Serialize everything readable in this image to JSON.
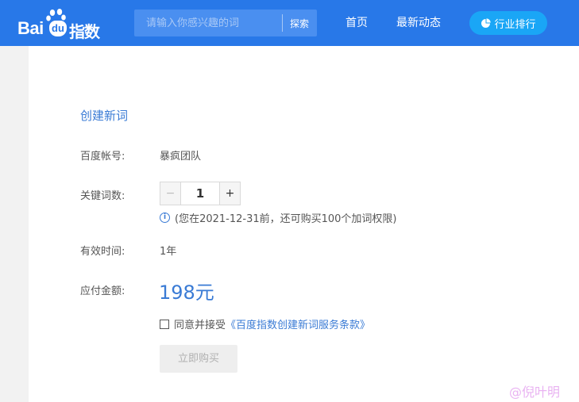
{
  "header": {
    "logo_text_left": "Bai",
    "logo_text_mid": "du",
    "logo_text_right": "指数",
    "search": {
      "placeholder": "请输入你感兴趣的词",
      "button": "探索"
    },
    "nav": [
      "首页",
      "最新动态"
    ],
    "rank_button": "行业排行",
    "colors": {
      "bar": "#2878e8",
      "rank_button": "#1aa6f6"
    }
  },
  "form": {
    "title": "创建新词",
    "account_label": "百度帐号:",
    "account_value": "暴疯团队",
    "keyword_count_label": "关键词数:",
    "stepper": {
      "minus": "−",
      "value": "1",
      "plus": "+"
    },
    "note": "(您在2021-12-31前，还可购买100个加词权限)",
    "duration_label": "有效时间:",
    "duration_value": "1年",
    "amount_label": "应付金额:",
    "amount_value": "198元",
    "agree_text": "同意并接受",
    "agree_link": "《百度指数创建新词服务条款》",
    "agree_checked": false,
    "buy_button": "立即购买"
  },
  "watermark": "@倪叶明"
}
